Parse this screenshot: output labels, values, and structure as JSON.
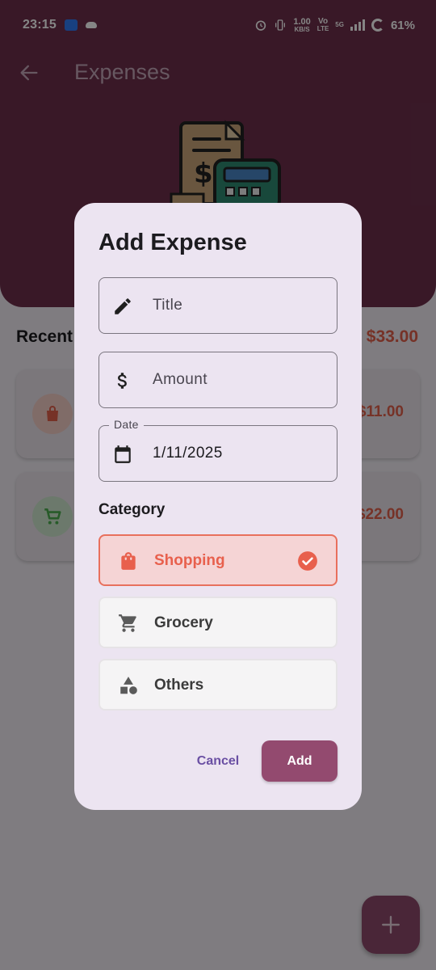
{
  "status_bar": {
    "time": "23:15",
    "net_speed": "1.00",
    "net_unit": "KB/S",
    "volte_top": "Vo",
    "volte_bottom": "LTE",
    "signal_label": "5G",
    "battery": "61%"
  },
  "app_bar": {
    "title": "Expenses",
    "back_icon": "arrow-back-icon"
  },
  "background": {
    "recent_heading": "Recent",
    "total_amount": "$33.00",
    "expenses": [
      {
        "icon": "shopping-bag-icon",
        "icon_color": "#e2604c",
        "amount": "$11.00"
      },
      {
        "icon": "cart-icon",
        "icon_color": "#4caf50",
        "amount": "$22.00"
      }
    ],
    "fab_icon": "plus-icon"
  },
  "dialog": {
    "title": "Add Expense",
    "fields": {
      "title": {
        "placeholder": "Title",
        "icon": "pencil-icon"
      },
      "amount": {
        "placeholder": "Amount",
        "icon": "dollar-icon"
      },
      "date": {
        "label": "Date",
        "value": "1/11/2025",
        "icon": "calendar-icon"
      }
    },
    "category_heading": "Category",
    "categories": [
      {
        "label": "Shopping",
        "icon": "shopping-bag-icon",
        "selected": true
      },
      {
        "label": "Grocery",
        "icon": "cart-icon",
        "selected": false
      },
      {
        "label": "Others",
        "icon": "shapes-icon",
        "selected": false
      }
    ],
    "cancel_label": "Cancel",
    "add_label": "Add"
  },
  "colors": {
    "header": "#6e2f4c",
    "accent": "#934a6f",
    "selected_category": "#e8604d",
    "cancel_text": "#6a4fa3"
  }
}
